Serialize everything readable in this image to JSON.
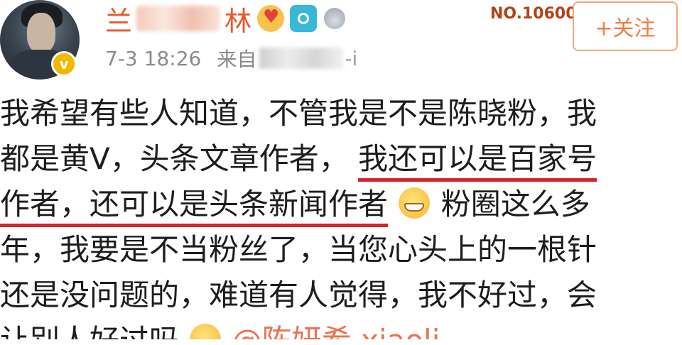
{
  "post": {
    "author": {
      "name_start": "兰",
      "name_end": "林",
      "badges": [
        "heart-badge-icon",
        "camera-badge-icon",
        "medal-badge-icon"
      ]
    },
    "rank_label": "NO.10600",
    "follow_label": "+关注",
    "time": "7-3 18:26",
    "source_label": "来自",
    "source_tail": "-i",
    "lines": [
      "我希望有些人知道，不管我是不是陈晓粉，我",
      "都是黄V，头条文章作者，",
      "我还可以是百家号",
      "作者，还可以是头条新闻作者",
      "粉圈这么多",
      "年，我要是不当粉丝了，当您心头上的一根针",
      "还是没问题的，难道有人觉得，我不好过，会",
      "让别人好过吗",
      "@陈妍希 xiaoli"
    ]
  },
  "colors": {
    "accent_name": "#e8582a",
    "underline": "#d8232a",
    "follow_border": "#f3a77f",
    "follow_text": "#ef7b45",
    "body_text": "#1d1d1d",
    "meta_text": "#8a8a8a"
  }
}
